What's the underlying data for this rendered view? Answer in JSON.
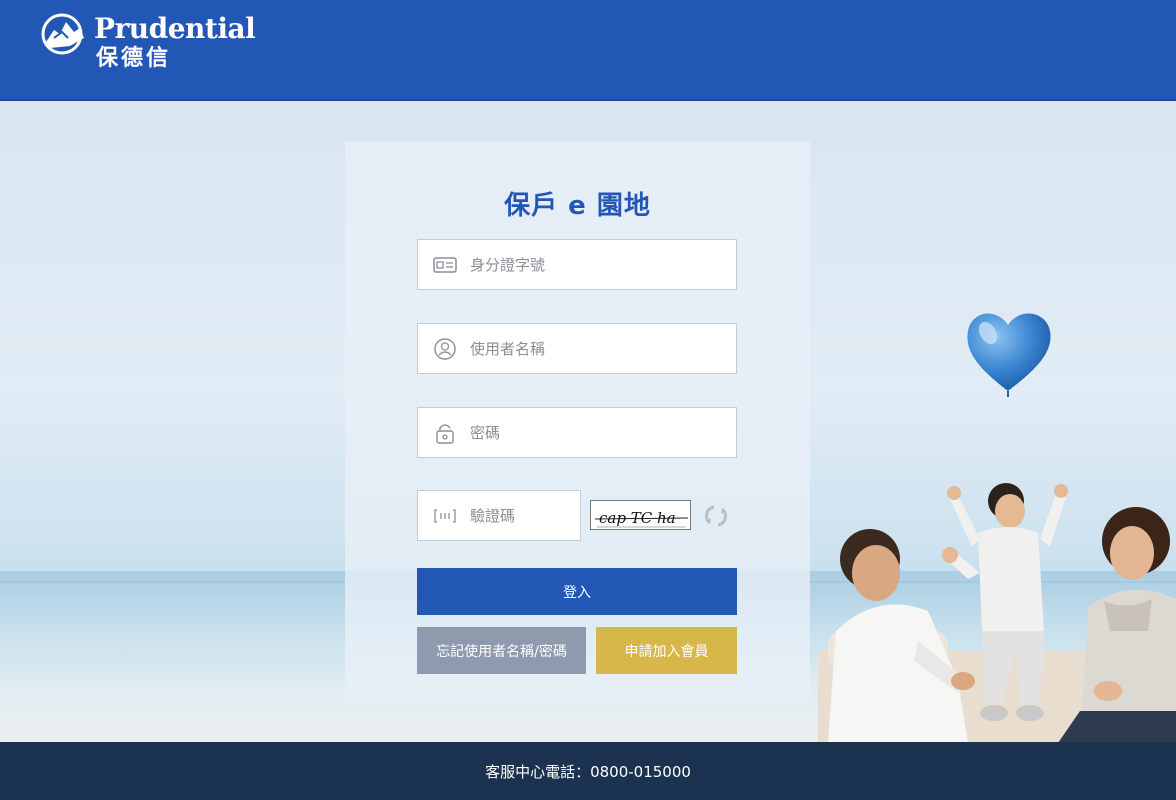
{
  "header": {
    "brand_en": "Prudential",
    "brand_zh": "保德信"
  },
  "login": {
    "title": "保戶 e 園地",
    "id_placeholder": "身分證字號",
    "username_placeholder": "使用者名稱",
    "password_placeholder": "密碼",
    "captcha_placeholder": "驗證碼",
    "captcha_text": "cap TC ha",
    "login_button": "登入",
    "forgot_button": "忘記使用者名稱/密碼",
    "join_button": "申請加入會員"
  },
  "footer": {
    "hotline": "客服中心電話：0800-015000"
  },
  "colors": {
    "brand_blue": "#2357b6",
    "forgot_gray": "#8e9aad",
    "join_gold": "#d8b74a",
    "footer_navy": "#1b3350"
  },
  "icons": {
    "id": "id-card-icon",
    "user": "user-icon",
    "password": "lock-icon",
    "captcha": "captcha-icon",
    "refresh": "refresh-icon"
  }
}
